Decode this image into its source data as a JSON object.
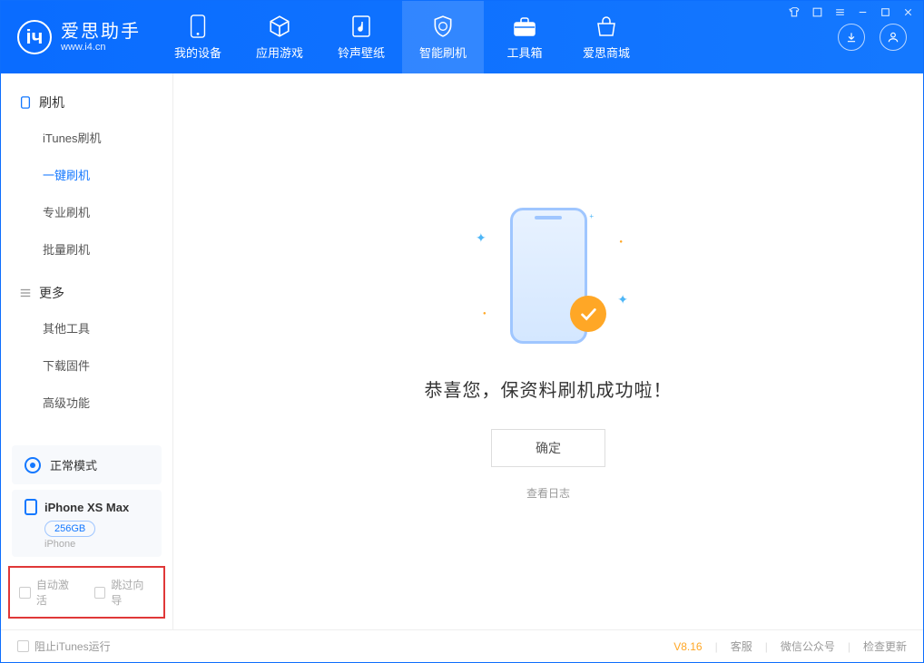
{
  "app": {
    "title": "爱思助手",
    "subtitle": "www.i4.cn"
  },
  "tabs": [
    {
      "label": "我的设备"
    },
    {
      "label": "应用游戏"
    },
    {
      "label": "铃声壁纸"
    },
    {
      "label": "智能刷机"
    },
    {
      "label": "工具箱"
    },
    {
      "label": "爱思商城"
    }
  ],
  "sidebar": {
    "section1": {
      "title": "刷机",
      "items": [
        "iTunes刷机",
        "一键刷机",
        "专业刷机",
        "批量刷机"
      ]
    },
    "section2": {
      "title": "更多",
      "items": [
        "其他工具",
        "下载固件",
        "高级功能"
      ]
    },
    "mode": "正常模式",
    "device": {
      "name": "iPhone XS Max",
      "storage": "256GB",
      "type": "iPhone"
    },
    "checkboxes": {
      "auto_activate": "自动激活",
      "skip_guide": "跳过向导"
    }
  },
  "main": {
    "success_text": "恭喜您，保资料刷机成功啦！",
    "ok_button": "确定",
    "view_log": "查看日志"
  },
  "footer": {
    "block_itunes": "阻止iTunes运行",
    "version": "V8.16",
    "links": [
      "客服",
      "微信公众号",
      "检查更新"
    ]
  }
}
